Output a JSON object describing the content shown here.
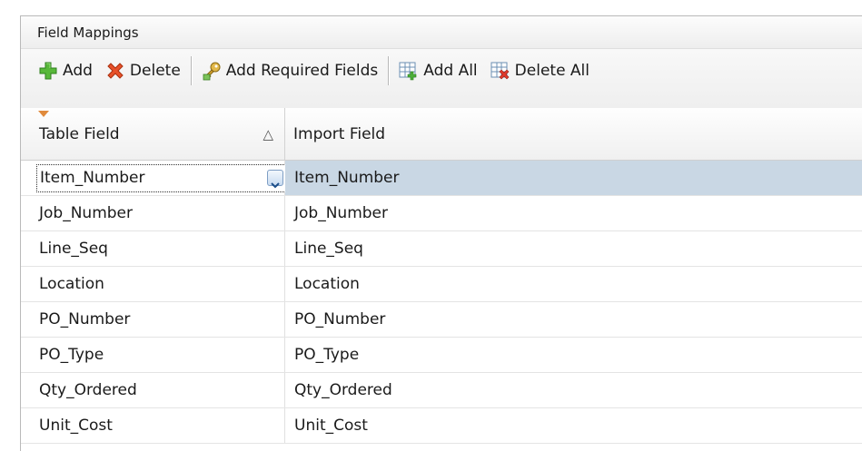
{
  "panel": {
    "title": "Field Mappings"
  },
  "toolbar": {
    "add_label": "Add",
    "delete_label": "Delete",
    "add_required_label": "Add Required Fields",
    "add_all_label": "Add All",
    "delete_all_label": "Delete All"
  },
  "grid": {
    "columns": [
      "Table Field",
      "Import Field"
    ],
    "sort_indicator": "△",
    "editing_value": "Item_Number",
    "rows": [
      {
        "table_field": "Item_Number",
        "import_field": "Item_Number"
      },
      {
        "table_field": "Job_Number",
        "import_field": "Job_Number"
      },
      {
        "table_field": "Line_Seq",
        "import_field": "Line_Seq"
      },
      {
        "table_field": "Location",
        "import_field": "Location"
      },
      {
        "table_field": "PO_Number",
        "import_field": "PO_Number"
      },
      {
        "table_field": "PO_Type",
        "import_field": "PO_Type"
      },
      {
        "table_field": "Qty_Ordered",
        "import_field": "Qty_Ordered"
      },
      {
        "table_field": "Unit_Cost",
        "import_field": "Unit_Cost"
      }
    ]
  },
  "icons": {
    "add": "plus-icon",
    "delete": "x-icon",
    "add_required": "key-icon",
    "add_all": "table-add-icon",
    "delete_all": "table-delete-icon"
  }
}
